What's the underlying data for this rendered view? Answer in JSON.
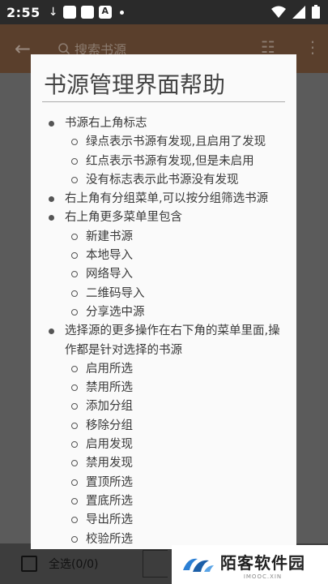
{
  "status_bar": {
    "time": "2:55"
  },
  "app_bar": {
    "search_placeholder": "搜索书源"
  },
  "bottom_bar": {
    "select_all_label": "全选(0/0)"
  },
  "dialog": {
    "title": "书源管理界面帮助",
    "sections": [
      {
        "text": "书源右上角标志",
        "subitems": [
          "绿点表示书源有发现,且启用了发现",
          "红点表示书源有发现,但是未启用",
          "没有标志表示此书源没有发现"
        ]
      },
      {
        "text": "右上角有分组菜单,可以按分组筛选书源",
        "subitems": []
      },
      {
        "text": "右上角更多菜单里包含",
        "subitems": [
          "新建书源",
          "本地导入",
          "网络导入",
          "二维码导入",
          "分享选中源"
        ]
      },
      {
        "text": "选择源的更多操作在右下角的菜单里面,操作都是针对选择的书源",
        "subitems": [
          "启用所选",
          "禁用所选",
          "添加分组",
          "移除分组",
          "启用发现",
          "禁用发现",
          "置顶所选",
          "置底所选",
          "导出所选",
          "校验所选"
        ]
      }
    ]
  },
  "watermark": {
    "brand": "陌客软件园",
    "domain": "IMOOC.XIN"
  }
}
